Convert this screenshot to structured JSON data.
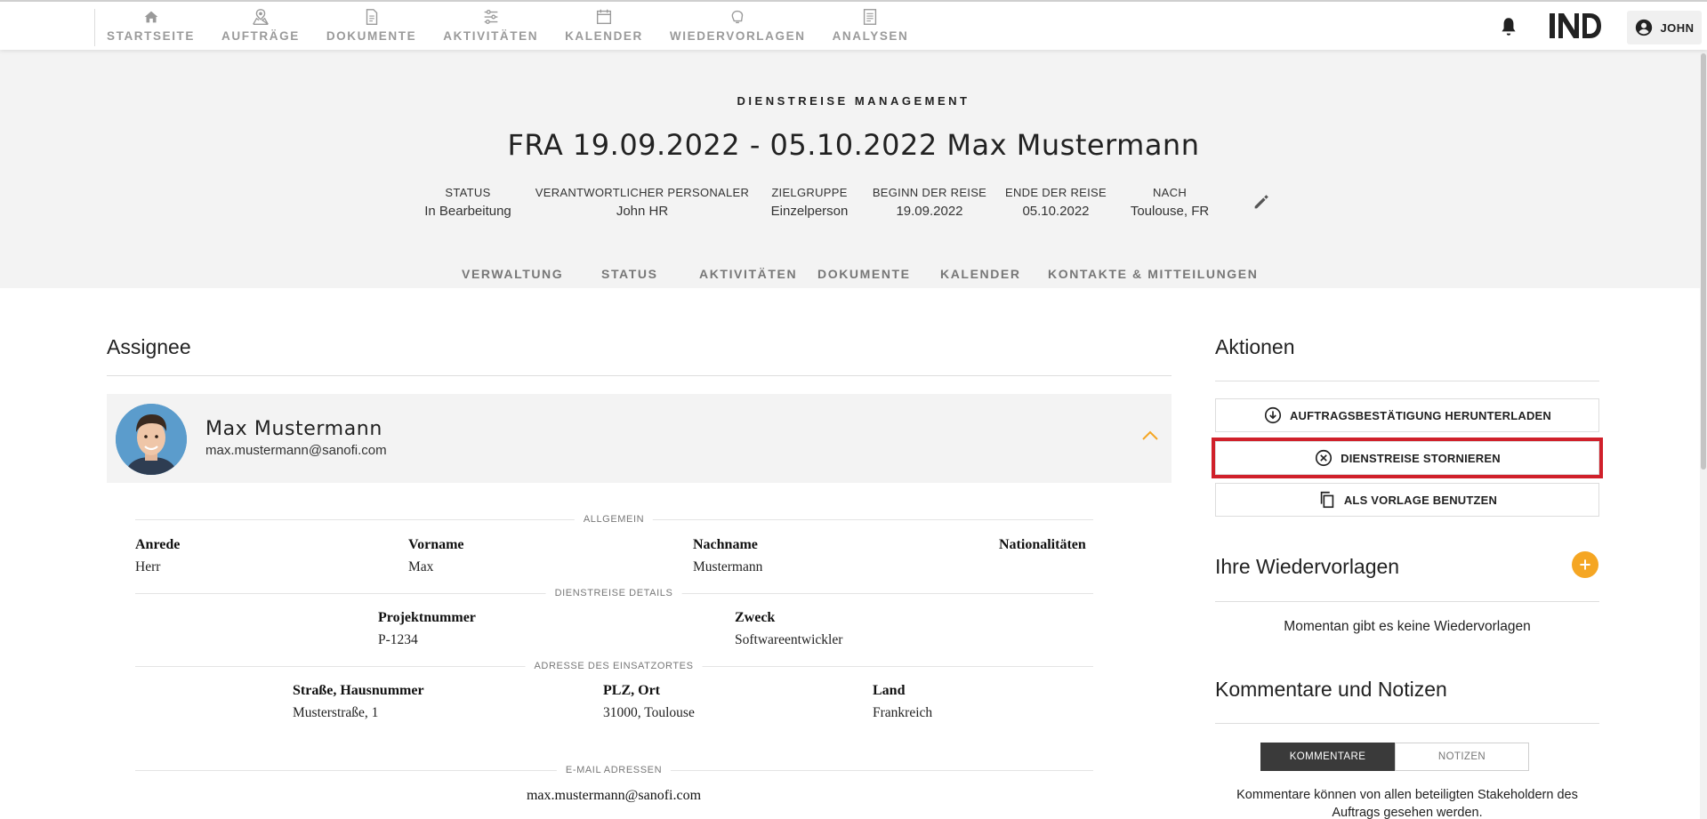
{
  "nav": {
    "items": [
      {
        "label": "STARTSEITE",
        "icon": "home-icon"
      },
      {
        "label": "AUFTRÄGE",
        "icon": "map-pin-icon"
      },
      {
        "label": "DOKUMENTE",
        "icon": "document-icon"
      },
      {
        "label": "AKTIVITÄTEN",
        "icon": "sliders-icon"
      },
      {
        "label": "KALENDER",
        "icon": "calendar-icon"
      },
      {
        "label": "WIEDERVORLAGEN",
        "icon": "bell-outline-icon"
      },
      {
        "label": "ANALYSEN",
        "icon": "report-icon"
      }
    ],
    "logo_text": "IND",
    "user_label": "JOHN"
  },
  "header": {
    "kicker": "DIENSTREISE MANAGEMENT",
    "title": "FRA 19.09.2022 - 05.10.2022 Max Mustermann",
    "meta": [
      {
        "key": "STATUS",
        "value": "In Bearbeitung"
      },
      {
        "key": "VERANTWORTLICHER PERSONALER",
        "value": "John HR"
      },
      {
        "key": "ZIELGRUPPE",
        "value": "Einzelperson"
      },
      {
        "key": "BEGINN DER REISE",
        "value": "19.09.2022"
      },
      {
        "key": "ENDE DER REISE",
        "value": "05.10.2022"
      },
      {
        "key": "NACH",
        "value": "Toulouse, FR"
      }
    ],
    "tabs": [
      "VERWALTUNG",
      "STATUS",
      "AKTIVITÄTEN",
      "DOKUMENTE",
      "KALENDER",
      "KONTAKTE & MITTEILUNGEN"
    ]
  },
  "assignee": {
    "heading": "Assignee",
    "name": "Max Mustermann",
    "email": "max.mustermann@sanofi.com",
    "groups": {
      "general": "ALLGEMEIN",
      "trip": "DIENSTREISE DETAILS",
      "address": "ADRESSE DES EINSATZORTES",
      "emails": "E-MAIL ADRESSEN"
    },
    "fields": {
      "anrede": {
        "label": "Anrede",
        "value": "Herr"
      },
      "vorname": {
        "label": "Vorname",
        "value": "Max"
      },
      "nachname": {
        "label": "Nachname",
        "value": "Mustermann"
      },
      "nationalitaet": {
        "label": "Nationalitäten",
        "value": ""
      },
      "projekt": {
        "label": "Projektnummer",
        "value": "P-1234"
      },
      "zweck": {
        "label": "Zweck",
        "value": "Softwareentwickler"
      },
      "strasse": {
        "label": "Straße, Hausnummer",
        "value": "Musterstraße, 1"
      },
      "plz": {
        "label": "PLZ, Ort",
        "value": "31000, Toulouse"
      },
      "land": {
        "label": "Land",
        "value": "Frankreich"
      }
    },
    "email_list": "max.mustermann@sanofi.com"
  },
  "actions": {
    "heading": "Aktionen",
    "download": "AUFTRAGSBESTÄTIGUNG HERUNTERLADEN",
    "cancel": "DIENSTREISE STORNIEREN",
    "template": "ALS VORLAGE BENUTZEN"
  },
  "followups": {
    "heading": "Ihre Wiedervorlagen",
    "empty": "Momentan gibt es keine Wiedervorlagen"
  },
  "comments": {
    "heading": "Kommentare und Notizen",
    "tab_comments": "KOMMENTARE",
    "tab_notes": "NOTIZEN",
    "info": "Kommentare können von allen beteiligten Stakeholdern des Auftrags gesehen werden."
  },
  "colors": {
    "accent": "#f5a623",
    "highlight": "#d0202a",
    "header_bg": "#f3f3f3"
  }
}
